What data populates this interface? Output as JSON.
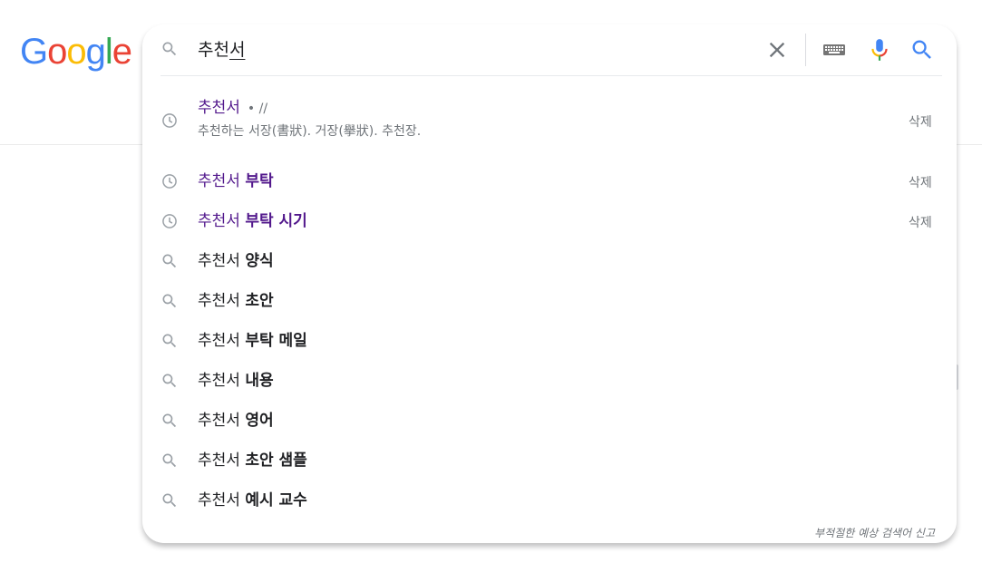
{
  "logo": {
    "text": "Google"
  },
  "search": {
    "query_prefix": "추천",
    "query_composing": "서"
  },
  "suggestions": [
    {
      "kind": "history",
      "typed": "추천서",
      "meta": "• //",
      "description": "추천하는 서장(書狀). 거장(擧狀). 추천장.",
      "delete_label": "삭제"
    },
    {
      "kind": "history",
      "typed": "추천서",
      "completion": "부탁",
      "delete_label": "삭제"
    },
    {
      "kind": "history",
      "typed": "추천서",
      "completion": "부탁 시기",
      "delete_label": "삭제"
    },
    {
      "kind": "search",
      "typed": "추천서",
      "completion": "양식"
    },
    {
      "kind": "search",
      "typed": "추천서",
      "completion": "초안"
    },
    {
      "kind": "search",
      "typed": "추천서",
      "completion": "부탁 메일"
    },
    {
      "kind": "search",
      "typed": "추천서",
      "completion": "내용"
    },
    {
      "kind": "search",
      "typed": "추천서",
      "completion": "영어"
    },
    {
      "kind": "search",
      "typed": "추천서",
      "completion": "초안 샘플"
    },
    {
      "kind": "search",
      "typed": "추천서",
      "completion": "예시 교수"
    }
  ],
  "footer": {
    "report_label": "부적절한 예상 검색어 신고"
  },
  "icons": {
    "clear": "close-icon",
    "keyboard": "keyboard-icon",
    "voice": "microphone-icon",
    "search": "search-icon",
    "history": "history-clock-icon"
  },
  "colors": {
    "history_text": "#52188c",
    "text": "#202124",
    "secondary": "#70757a",
    "search_blue": "#4285f4"
  }
}
